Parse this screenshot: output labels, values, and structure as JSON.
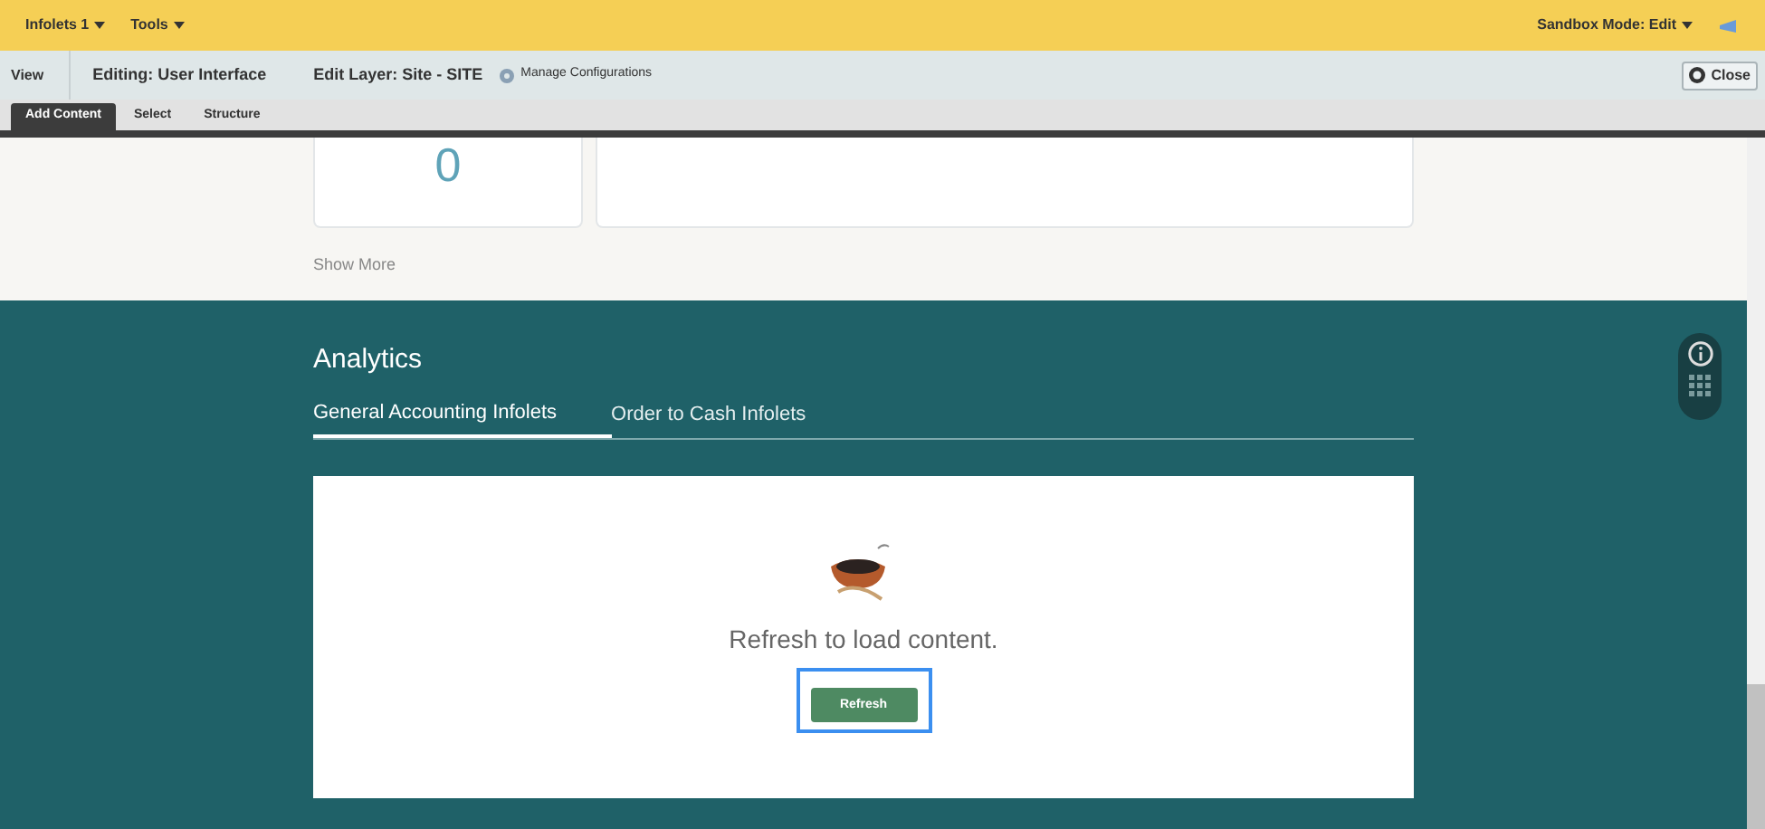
{
  "top_bar": {
    "menus": [
      "Infolets 1",
      "Tools"
    ],
    "sandbox_mode": "Sandbox Mode: Edit"
  },
  "edit_bar": {
    "view": "View",
    "editing": "Editing: User Interface",
    "edit_layer": "Edit Layer: Site - SITE",
    "manage": "Manage Configurations",
    "close": "Close"
  },
  "edit_tabs": [
    {
      "label": "Add Content",
      "selected": true
    },
    {
      "label": "Select",
      "selected": false
    },
    {
      "label": "Structure",
      "selected": false
    }
  ],
  "cards": {
    "count": "0",
    "show_more": "Show More"
  },
  "analytics": {
    "title": "Analytics",
    "tabs": [
      {
        "label": "General Accounting Infolets",
        "selected": true
      },
      {
        "label": "Order to Cash Infolets",
        "selected": false
      }
    ],
    "message": "Refresh to load content.",
    "refresh": "Refresh"
  }
}
